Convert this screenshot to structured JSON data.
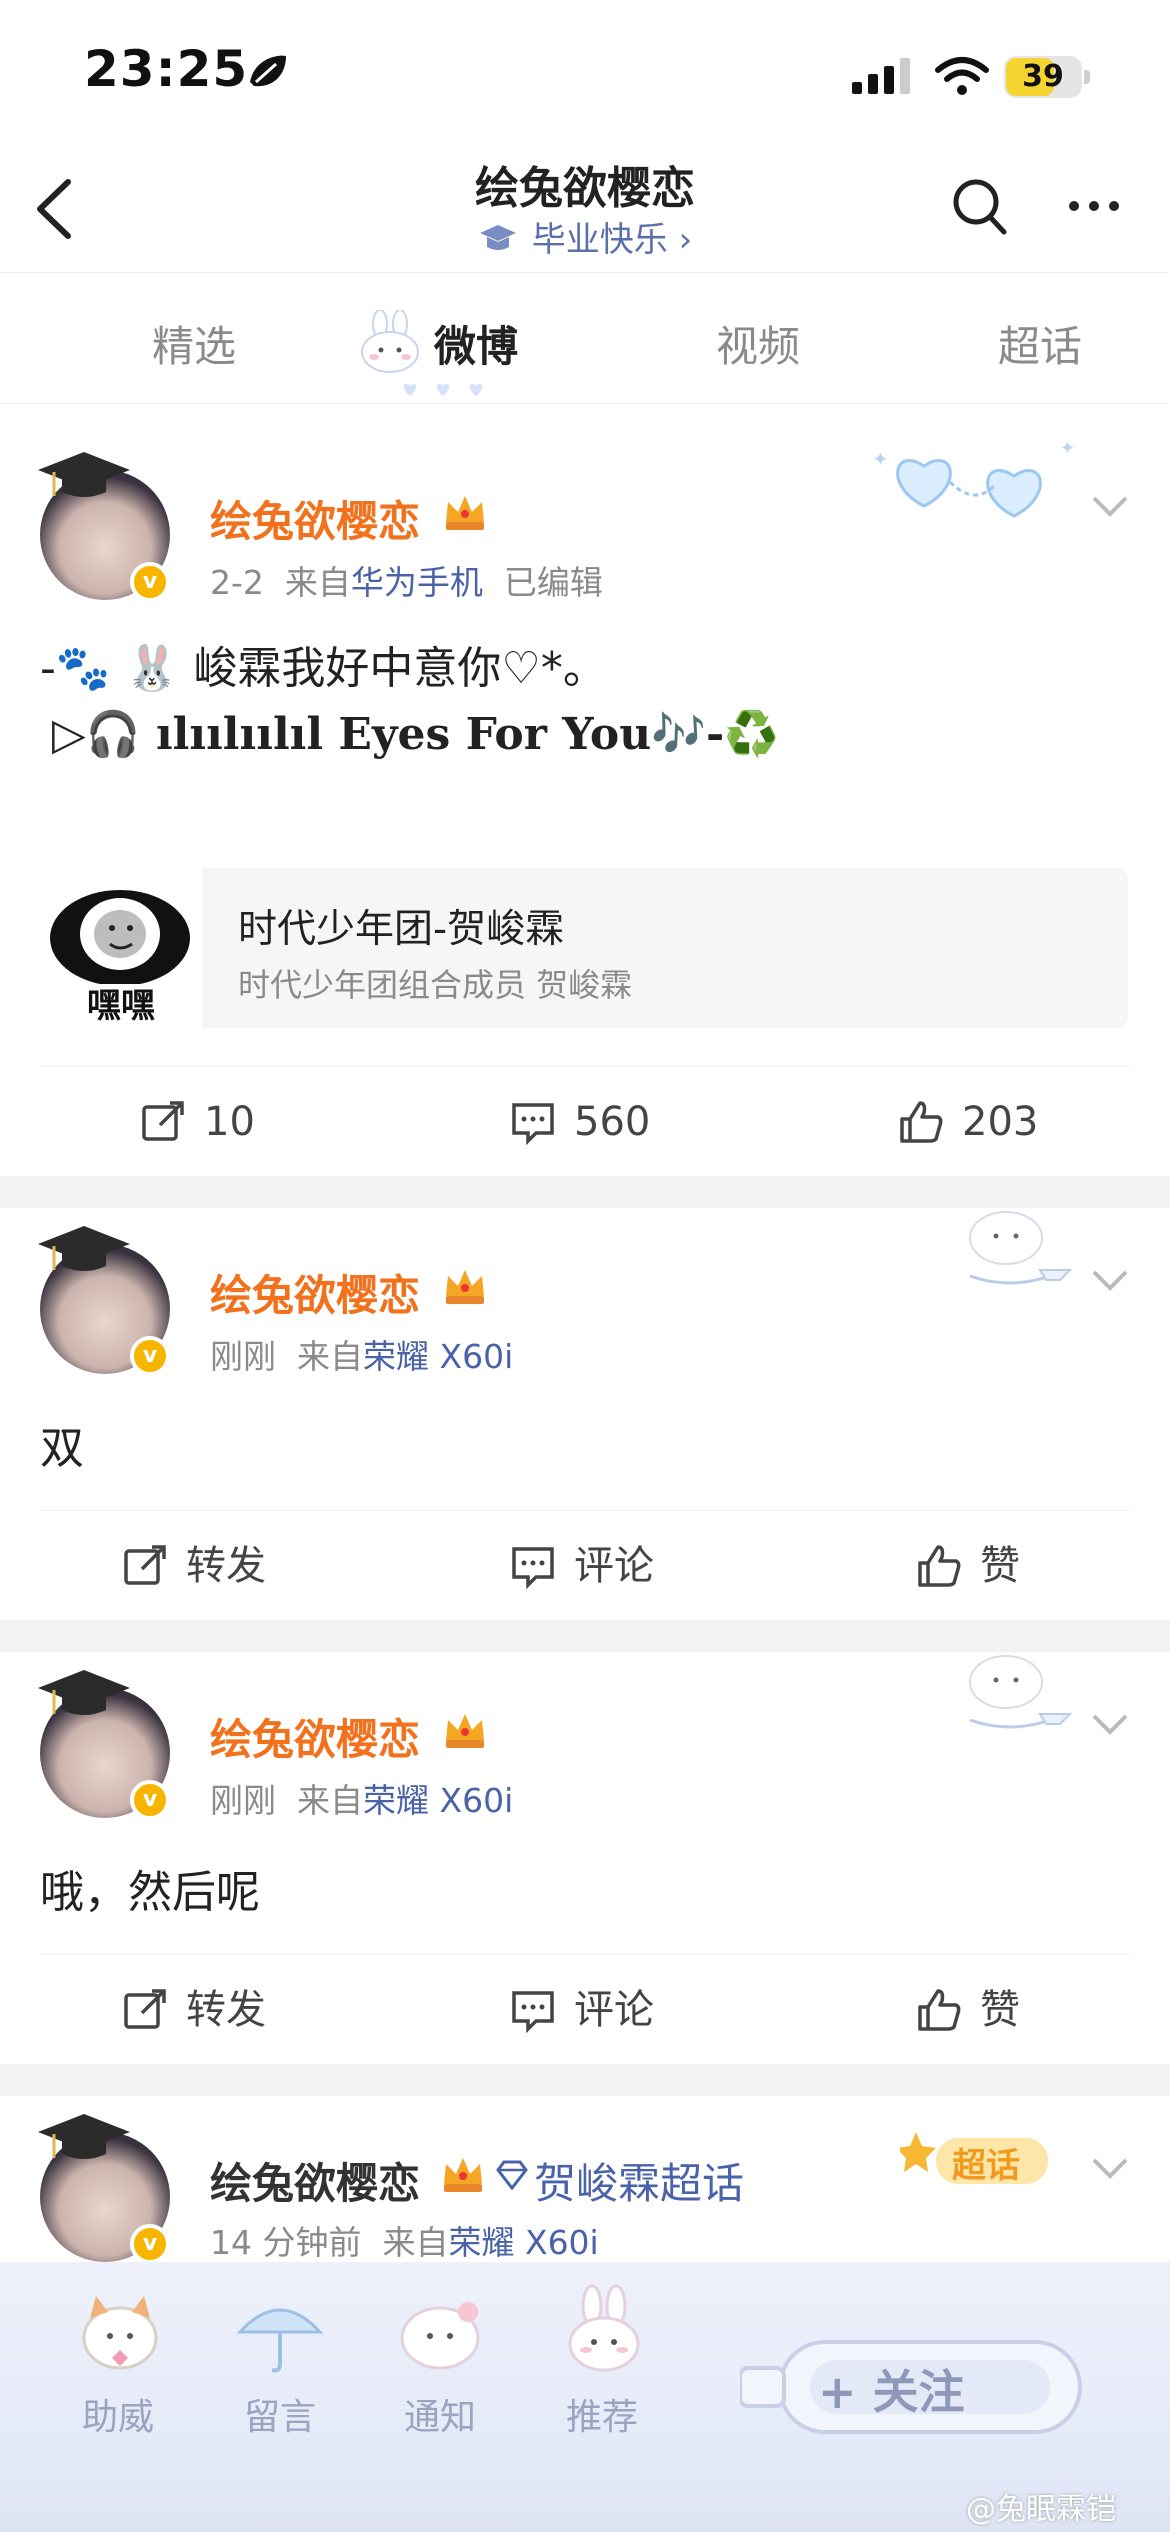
{
  "status_bar": {
    "time": "23:25",
    "battery": "39"
  },
  "header": {
    "title": "绘兔欲樱恋",
    "subtitle": "毕业快乐",
    "subtitle_chevron": "›"
  },
  "tabs": [
    {
      "label": "精选"
    },
    {
      "label": "微博"
    },
    {
      "label": "视频"
    },
    {
      "label": "超话"
    }
  ],
  "posts": [
    {
      "username": "绘兔欲樱恋",
      "time": "2-2",
      "from_prefix": "来自",
      "source": "华为手机",
      "edited": "已编辑",
      "line1": "-🐾 🐰 峻霖我好中意你♡*。",
      "line2": "▷🎧 ılıılıılıl Eyes For You🎶-♻️",
      "card": {
        "thumb_text": "嘿嘿",
        "title": "时代少年团-贺峻霖",
        "desc": "时代少年团组合成员 贺峻霖"
      },
      "repost": "10",
      "comment": "560",
      "like": "203"
    },
    {
      "username": "绘兔欲樱恋",
      "time": "刚刚",
      "from_prefix": "来自",
      "source": "荣耀 X60i",
      "text": "双",
      "repost": "转发",
      "comment": "评论",
      "like": "赞"
    },
    {
      "username": "绘兔欲樱恋",
      "time": "刚刚",
      "from_prefix": "来自",
      "source": "荣耀 X60i",
      "text": "哦，然后呢",
      "repost": "转发",
      "comment": "评论",
      "like": "赞"
    },
    {
      "username": "绘兔欲樱恋",
      "topic": "贺峻霖超话",
      "time": "14 分钟前",
      "from_prefix": "来自",
      "source": "荣耀 X60i",
      "deco_label": "超话"
    }
  ],
  "bottom_bar": {
    "items": [
      {
        "label": "助威"
      },
      {
        "label": "留言"
      },
      {
        "label": "通知"
      },
      {
        "label": "推荐"
      }
    ],
    "follow": "+ 关注"
  },
  "watermark": "@兔眠霖铠",
  "colors": {
    "username": "#f2711c",
    "link": "#4a62a8",
    "verified": "#f7b500"
  }
}
